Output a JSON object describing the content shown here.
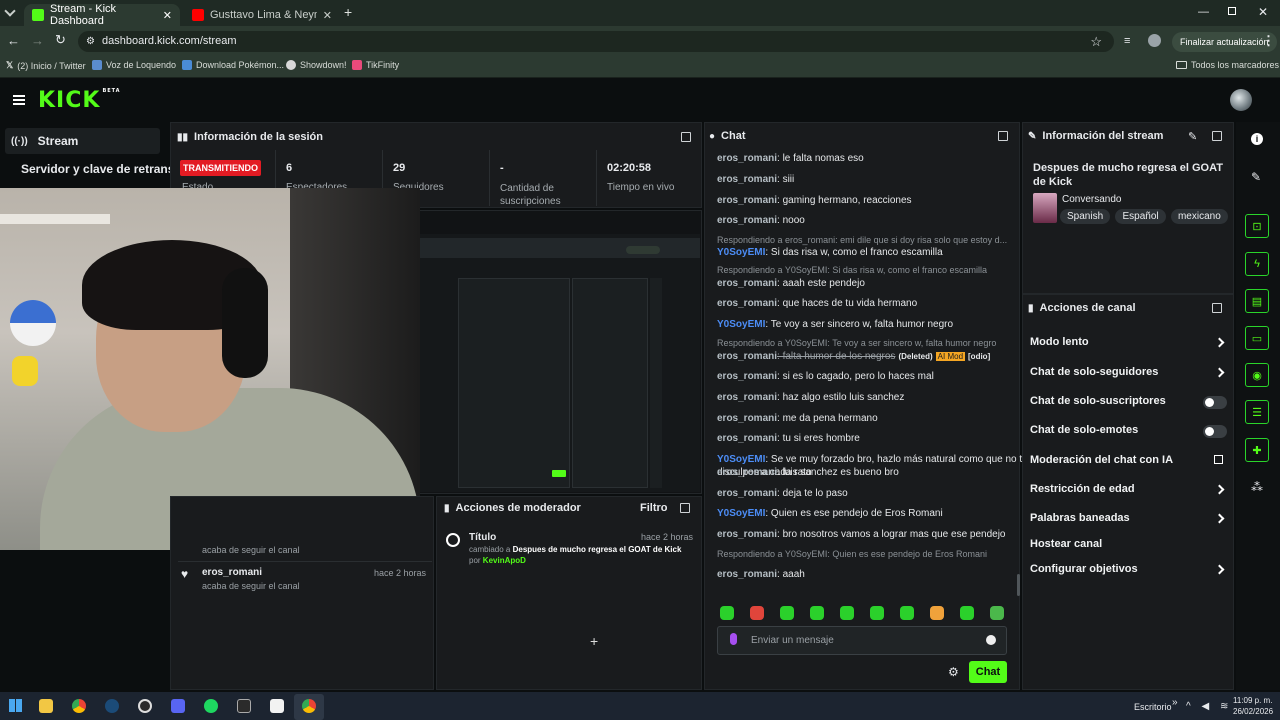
{
  "browser": {
    "tabs": [
      {
        "title": "Stream - Kick Dashboard",
        "active": true
      },
      {
        "title": "Gusttavo Lima & Neymar - BAL"
      }
    ],
    "url": "dashboard.kick.com/stream",
    "update_button": "Finalizar actualización",
    "bookmarks": [
      "(2) Inicio / Twitter",
      "Voz de Loquendo",
      "Download Pokémon...",
      "Showdown!",
      "TikFinity"
    ],
    "all_bookmarks": "Todos los marcadores"
  },
  "kick": {
    "logo": "KICK",
    "logo_badge": "BETA",
    "sidebar": {
      "stream": "Stream",
      "key": "Servidor y clave de retransmisión"
    }
  },
  "session": {
    "title": "Información de la sesión",
    "status": "TRANSMITIENDO",
    "status_sub": "Estado",
    "stats": [
      {
        "value": "6",
        "label": "Espectadores"
      },
      {
        "value": "29",
        "label": "Seguidores"
      },
      {
        "value": "-",
        "label": "Cantidad de suscripciones"
      },
      {
        "value": "02:20:58",
        "label": "Tiempo en vivo"
      }
    ]
  },
  "activity": [
    {
      "user": "eros_romani",
      "text": "acaba de seguir el canal",
      "time": "hace 2 horas"
    }
  ],
  "activity_partial": "acaba de seguir el canal",
  "moderator": {
    "title": "Acciones de moderador",
    "filter": "Filtro",
    "entry_title": "Título",
    "entry_time": "hace 2 horas",
    "entry_prefix": "cambiado a",
    "entry_value": "Despues de mucho regresa el GOAT de Kick",
    "entry_by_prefix": "por",
    "entry_by": "KevinApoD"
  },
  "chat": {
    "title": "Chat",
    "messages": [
      {
        "user": "eros_romani",
        "text": ": le falta nomas eso"
      },
      {
        "user": "eros_romani",
        "text": ": siii"
      },
      {
        "user": "eros_romani",
        "text": ": gaming hermano, reacciones"
      },
      {
        "user": "eros_romani",
        "text": ": nooo"
      },
      {
        "reply": "Respondiendo a eros_romani: emi dile que si doy risa solo que estoy d..."
      },
      {
        "user": "Y0SoyEMI",
        "text": ": Si das risa w, como el franco escamilla",
        "blue": true
      },
      {
        "reply": "Respondiendo a Y0SoyEMI: Si das risa w, como el franco escamilla"
      },
      {
        "user": "eros_romani",
        "text": ": aaah este pendejo"
      },
      {
        "user": "eros_romani",
        "text": ": que haces de tu vida hermano"
      },
      {
        "user": "Y0SoyEMI",
        "text": ": Te voy a ser sincero w, falta humor negro",
        "blue": true
      },
      {
        "reply": "Respondiendo a Y0SoyEMI: Te voy a ser sincero w, falta humor negro"
      },
      {
        "user": "eros_romani",
        "text": ": falta humor de los negros",
        "deleted": "(Deleted)",
        "ai": "AI Mod",
        "tag": "[odio]"
      },
      {
        "user": "eros_romani",
        "text": ": si es lo cagado, pero lo haces mal"
      },
      {
        "user": "eros_romani",
        "text": ": haz algo estilo luis sanchez"
      },
      {
        "user": "eros_romani",
        "text": ": me da pena hermano"
      },
      {
        "user": "eros_romani",
        "text": ": tu si eres hombre"
      },
      {
        "user": "Y0SoyEMI",
        "text": ": Se ve muy forzado bro, hazlo más natural como que no te",
        "text2": "disculpes a cada rato",
        "blue": true
      },
      {
        "user": "eros_romani",
        "text": ": luis sanchez es bueno bro"
      },
      {
        "user": "eros_romani",
        "text": ": deja te lo paso"
      },
      {
        "user": "Y0SoyEMI",
        "text": ": Quien es ese pendejo de Eros Romani",
        "blue": true
      },
      {
        "user": "eros_romani",
        "text": ": bro nosotros vamos a lograr mas que ese pendejo"
      },
      {
        "reply": "Respondiendo a Y0SoyEMI: Quien es ese pendejo de Eros Romani"
      },
      {
        "user": "eros_romani",
        "text": ": aaah"
      }
    ],
    "input_placeholder": "Enviar un mensaje",
    "send": "Chat"
  },
  "stream_info": {
    "title": "Información del stream",
    "stream_title": "Despues de mucho regresa el GOAT de Kick",
    "category": "Conversando",
    "tags": [
      "Spanish",
      "Español",
      "mexicano"
    ]
  },
  "channel_actions": {
    "title": "Acciones de canal",
    "items": [
      {
        "label": "Modo lento",
        "kind": "chevron"
      },
      {
        "label": "Chat de solo-seguidores",
        "kind": "chevron"
      },
      {
        "label": "Chat de solo-suscriptores",
        "kind": "toggle"
      },
      {
        "label": "Chat de solo-emotes",
        "kind": "toggle"
      },
      {
        "label": "Moderación del chat con IA",
        "kind": "external"
      },
      {
        "label": "Restricción de edad",
        "kind": "chevron"
      },
      {
        "label": "Palabras baneadas",
        "kind": "chevron"
      },
      {
        "label": "Hostear canal",
        "kind": "none"
      },
      {
        "label": "Configurar objetivos",
        "kind": "chevron"
      }
    ]
  },
  "taskbar": {
    "desktop": "Escritorio",
    "time": "11:09 p. m.",
    "date": "26/02/2026"
  },
  "colors": {
    "kick_green": "#53fc18",
    "live_red": "#e31b23",
    "username_blue": "#4c8df6",
    "ai_mod": "#f5a623"
  }
}
